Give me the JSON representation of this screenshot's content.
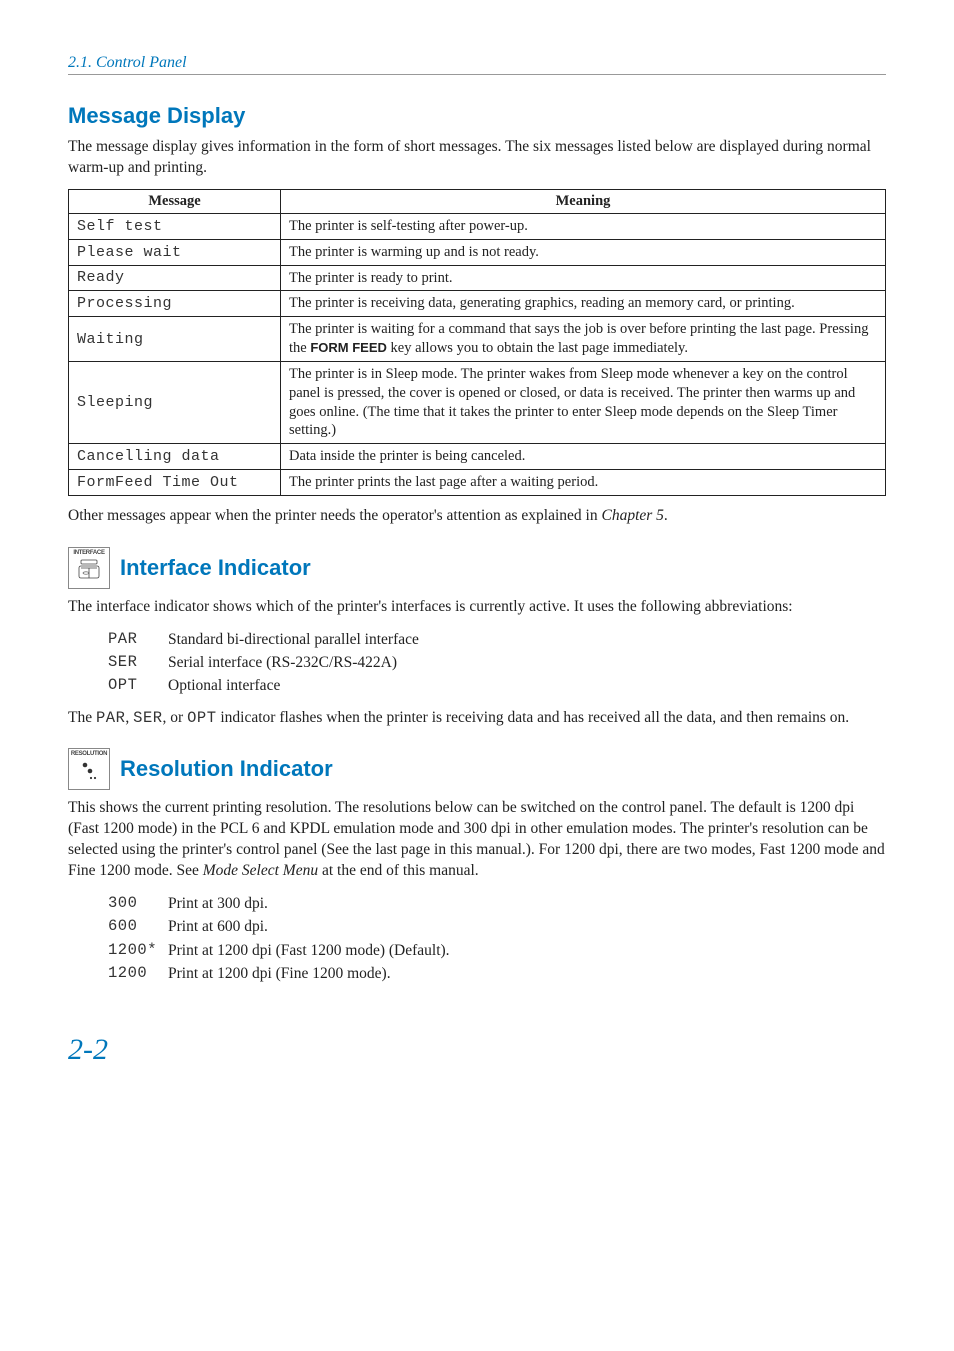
{
  "breadcrumb": "2.1. Control Panel",
  "sections": {
    "message_display": {
      "heading": "Message Display",
      "intro": "The message display gives information in the form of short messages. The six messages listed below are displayed during normal warm-up and printing.",
      "headers": {
        "col1": "Message",
        "col2": "Meaning"
      },
      "rows": [
        {
          "msg": "Self test",
          "meaning": "The printer is self-testing after power-up."
        },
        {
          "msg": "Please wait",
          "meaning": "The printer is warming up and is not ready."
        },
        {
          "msg": "Ready",
          "meaning": "The printer is ready to print."
        },
        {
          "msg": "Processing",
          "meaning": "The printer is receiving data, generating graphics, reading an memory card, or printing."
        },
        {
          "msg": "Waiting",
          "meaning_pre": "The printer is waiting for a command that says the job is over before printing the last page. Pressing the ",
          "key": "FORM FEED",
          "meaning_post": " key allows you to obtain the last page immediately."
        },
        {
          "msg": "Sleeping",
          "meaning": "The printer is in Sleep mode. The printer wakes from Sleep mode whenever a key on the control panel is pressed, the cover is opened or closed, or data is received. The printer then warms up and goes online. (The time that it takes the printer to enter Sleep mode depends on the Sleep Timer setting.)"
        },
        {
          "msg": "Cancelling data",
          "meaning": "Data inside the printer is being canceled."
        },
        {
          "msg": "FormFeed Time Out",
          "meaning": "The printer prints the last page after a waiting period."
        }
      ],
      "outro_pre": "Other messages appear when the printer needs the operator's attention as explained in ",
      "outro_em": "Chapter 5",
      "outro_post": "."
    },
    "interface_indicator": {
      "icon_label": "INTERFACE",
      "heading": "Interface Indicator",
      "intro": "The interface indicator shows which of the printer's interfaces is currently active. It uses the following abbreviations:",
      "abbrs": [
        {
          "code": "PAR",
          "desc": "Standard bi-directional parallel interface"
        },
        {
          "code": "SER",
          "desc": "Serial interface (RS-232C/RS-422A)"
        },
        {
          "code": "OPT",
          "desc": "Optional interface"
        }
      ],
      "tail_pre": "The ",
      "tail_codes": [
        "PAR",
        "SER",
        "OPT"
      ],
      "tail_mid1": ", ",
      "tail_mid2": ", or ",
      "tail_post": " indicator flashes when the printer is receiving data and has received all the data, and then remains on."
    },
    "resolution_indicator": {
      "icon_label": "RESOLUTION",
      "heading": "Resolution Indicator",
      "intro_pre": "This shows the current printing resolution. The resolutions below can be switched on the control panel. The default is 1200 dpi (Fast 1200 mode) in the PCL 6 and KPDL emulation mode and 300 dpi in other emulation modes. The printer's resolution can be selected using the printer's control panel (See the last page in this manual.). For 1200 dpi, there are two modes, Fast 1200 mode and Fine 1200 mode. See ",
      "intro_em": "Mode Select Menu",
      "intro_post": " at the end of this manual.",
      "rows": [
        {
          "code": "300",
          "desc": "Print at 300 dpi."
        },
        {
          "code": "600",
          "desc": "Print at 600 dpi."
        },
        {
          "code": "1200*",
          "desc": "Print at 1200 dpi (Fast 1200 mode) (Default)."
        },
        {
          "code": "1200",
          "desc": "Print at 1200 dpi (Fine 1200 mode)."
        }
      ]
    }
  },
  "page_number": "2-2"
}
